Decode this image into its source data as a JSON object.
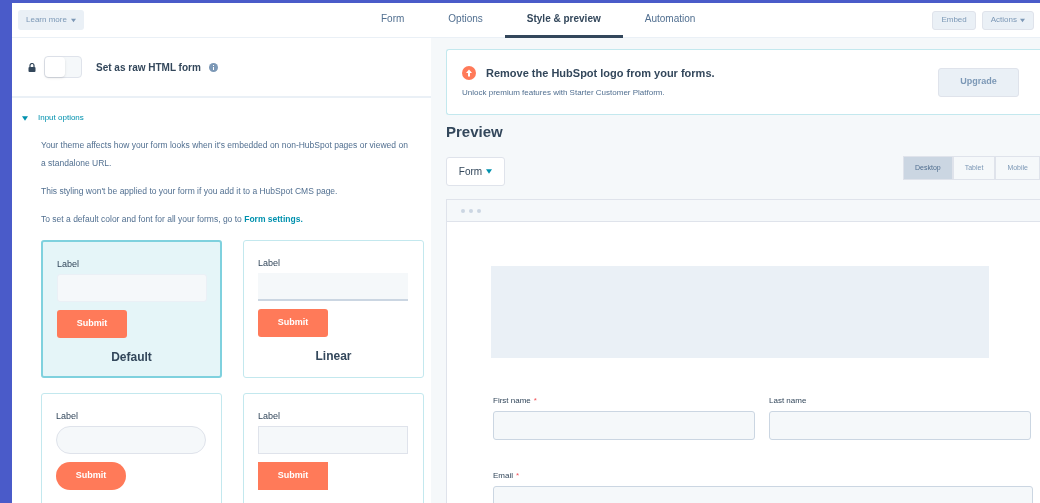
{
  "top_bar": {
    "learn_more": "Learn more",
    "tabs": [
      {
        "label": "Form",
        "selected": false
      },
      {
        "label": "Options",
        "selected": false
      },
      {
        "label": "Style & preview",
        "selected": true
      },
      {
        "label": "Automation",
        "selected": false
      }
    ],
    "buttons": [
      {
        "label": "Embed",
        "dropdown": false
      },
      {
        "label": "Actions",
        "dropdown": true
      }
    ]
  },
  "left_panel": {
    "raw_html": {
      "label": "Set as raw HTML form",
      "on": false
    },
    "input_options": {
      "title": "Input options",
      "expanded": true,
      "paragraphs": [
        {
          "text": "Your theme affects how your form looks when it's embedded on non-HubSpot pages or viewed on a standalone URL."
        },
        {
          "text": "This styling won't be applied to your form if you add it to a HubSpot CMS page."
        },
        {
          "text": "To set a default color and font for all your forms, go to",
          "link": "Form settings."
        }
      ],
      "styles": [
        {
          "kind": "default",
          "label": "Label",
          "button": "Submit",
          "name": "Default",
          "selected": true
        },
        {
          "kind": "linear",
          "label": "Label",
          "button": "Submit",
          "name": "Linear",
          "selected": false
        },
        {
          "kind": "rounded",
          "label": "Label",
          "button": "Submit",
          "selected": false
        },
        {
          "kind": "square",
          "label": "Label",
          "button": "Submit",
          "selected": false
        }
      ]
    }
  },
  "right_panel": {
    "banner": {
      "title": "Remove the HubSpot logo from your forms.",
      "text": "Unlock premium features with Starter Customer Platform.",
      "button": "Upgrade"
    },
    "preview_title": "Preview",
    "form_select": "Form",
    "devices": [
      {
        "label": "Desktop",
        "selected": true
      },
      {
        "label": "Tablet",
        "selected": false
      },
      {
        "label": "Mobile",
        "selected": false
      }
    ],
    "fields": [
      {
        "label": "First name",
        "required_mark": "*",
        "kind": "half"
      },
      {
        "label": "Last name",
        "kind": "half"
      },
      {
        "label": "Email",
        "required_mark": "*",
        "kind": "full"
      }
    ]
  }
}
